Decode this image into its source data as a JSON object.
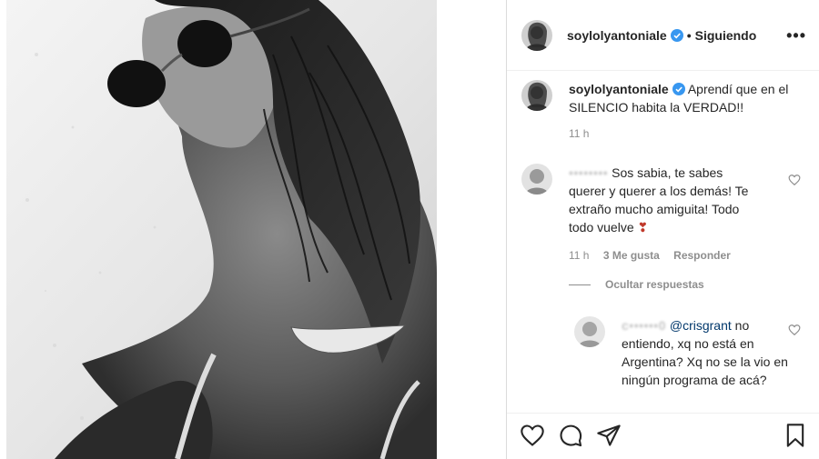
{
  "post": {
    "author": "soylolyantoniale",
    "follow_dot": "•",
    "follow_status": "Siguiendo",
    "more_label": "•••"
  },
  "caption": {
    "user": "soylolyantoniale",
    "text": "Aprendí que en el SILENCIO habita la VERDAD!!",
    "time": "11 h"
  },
  "comments": [
    {
      "user": "••••••••",
      "text": "Sos sabia, te sabes querer y querer a los demás! Te extraño mucho amiguita! Todo todo vuelve",
      "emoji": "❣",
      "time": "11 h",
      "likes": "3 Me gusta",
      "reply": "Responder",
      "hide_replies": "Ocultar respuestas",
      "replies": [
        {
          "user": "c••••••0",
          "mention": "@crisgrant",
          "text": "no entiendo, xq no está en Argentina? Xq no se la vio en ningún programa de acá?"
        }
      ]
    }
  ],
  "actions": {
    "like": "heart-icon",
    "comment": "comment-icon",
    "share": "share-icon",
    "save": "bookmark-icon"
  },
  "colors": {
    "text": "#262626",
    "secondary": "#8e8e8e",
    "verified": "#3897f0",
    "mention": "#00376b",
    "emoji_heart": "#c0392b"
  }
}
